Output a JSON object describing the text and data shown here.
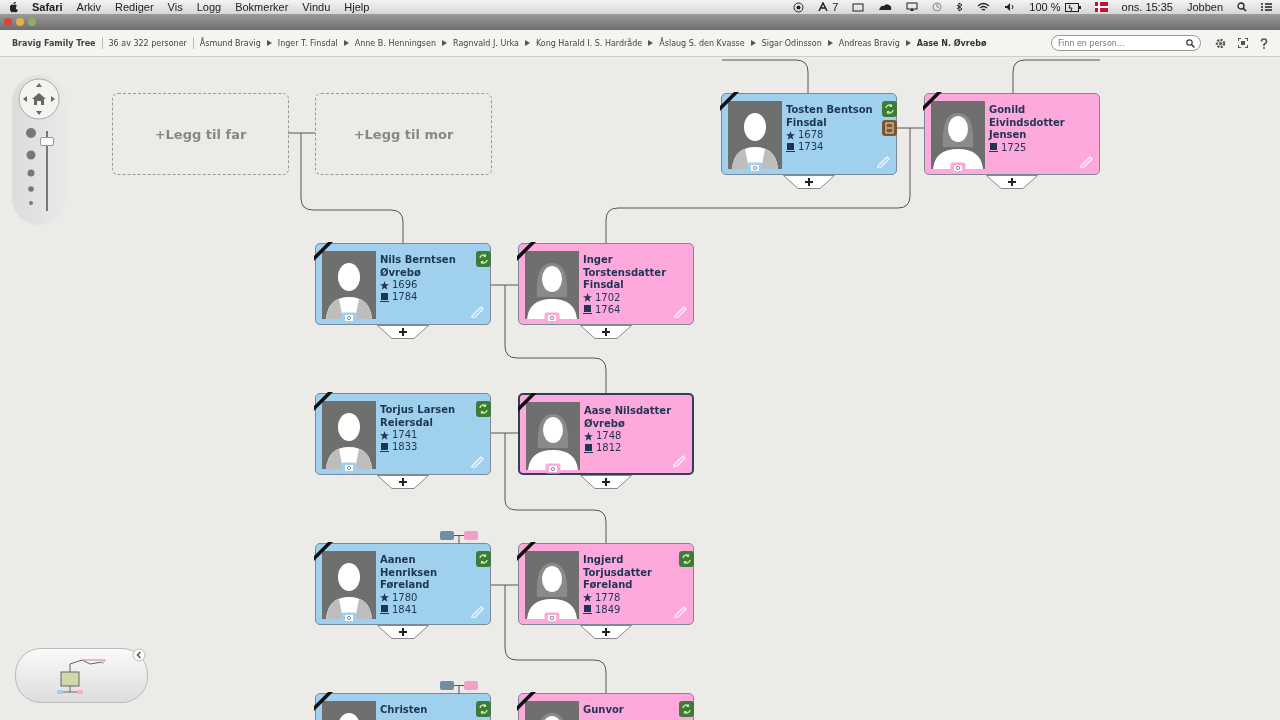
{
  "menubar": {
    "app": "Safari",
    "items": [
      "Arkiv",
      "Rediger",
      "Vis",
      "Logg",
      "Bokmerker",
      "Vindu",
      "Hjelp"
    ],
    "status": [
      "7",
      "100 %",
      "ons. 15:35",
      "Jobben"
    ]
  },
  "toolbar": {
    "tree_name": "Bravig Family Tree",
    "count": "36 av 322 personer",
    "breadcrumbs": [
      {
        "label": "Åsmund Bravig",
        "selected": false
      },
      {
        "label": "Inger T. Finsdal",
        "selected": false
      },
      {
        "label": "Anne B. Henningsen",
        "selected": false
      },
      {
        "label": "Ragnvald J. Urka",
        "selected": false
      },
      {
        "label": "Kong Harald I. S. Hardråde",
        "selected": false
      },
      {
        "label": "Åslaug S. den Kvasse",
        "selected": false
      },
      {
        "label": "Sigar Odinsson",
        "selected": false
      },
      {
        "label": "Andreas Bravig",
        "selected": false
      },
      {
        "label": "Aase N. Øvrebø",
        "selected": true
      }
    ],
    "search": {
      "placeholder": "Finn en person..."
    }
  },
  "zoom": {
    "level": 0.92
  },
  "placeholders": [
    {
      "label": "+Legg til far"
    },
    {
      "label": "+Legg til mor"
    }
  ],
  "persons": [
    {
      "kind": "male",
      "name": "Tosten Bentson\nFinsdal",
      "birth": "1678",
      "death": "1734",
      "sync": true,
      "record": true,
      "selected": false,
      "couple_switch": false
    },
    {
      "kind": "female",
      "name": "Gonild\nEivindsdotter\nJensen",
      "death": "1725",
      "sync": false,
      "record": false,
      "selected": false,
      "couple_switch": false
    },
    {
      "kind": "male",
      "name": "Nils Berntsen\nØvrebø",
      "birth": "1696",
      "death": "1784",
      "sync": true,
      "record": false,
      "selected": false,
      "couple_switch": false
    },
    {
      "kind": "female",
      "name": "Inger\nTorstensdatter\nFinsdal",
      "birth": "1702",
      "death": "1764",
      "sync": false,
      "record": false,
      "selected": false,
      "couple_switch": false
    },
    {
      "kind": "male",
      "name": "Torjus Larsen\nReiersdal",
      "birth": "1741",
      "death": "1833",
      "sync": true,
      "record": false,
      "selected": false,
      "couple_switch": false
    },
    {
      "kind": "female",
      "name": "Aase Nilsdatter\nØvrebø",
      "birth": "1748",
      "death": "1812",
      "sync": false,
      "record": false,
      "selected": true,
      "couple_switch": false
    },
    {
      "kind": "male",
      "name": "Aanen\nHenriksen\nFøreland",
      "birth": "1780",
      "death": "1841",
      "sync": true,
      "record": false,
      "selected": false,
      "couple_switch": true
    },
    {
      "kind": "female",
      "name": "Ingjerd\nTorjusdatter\nFøreland",
      "birth": "1778",
      "death": "1849",
      "sync": true,
      "record": false,
      "selected": false,
      "couple_switch": false
    },
    {
      "kind": "male",
      "name": "Christen",
      "sync": true,
      "record": false,
      "selected": false,
      "couple_switch": true
    },
    {
      "kind": "female",
      "name": "Gunvor",
      "sync": true,
      "record": false,
      "selected": false,
      "couple_switch": false
    }
  ]
}
